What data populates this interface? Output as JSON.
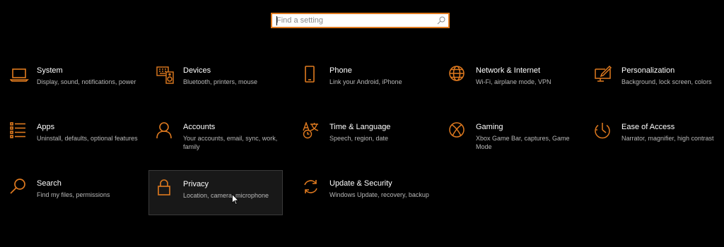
{
  "search": {
    "placeholder": "Find a setting",
    "value": ""
  },
  "accent_color": "#e07a1f",
  "tiles": [
    {
      "title": "System",
      "desc": "Display, sound, notifications, power",
      "icon": "laptop-icon"
    },
    {
      "title": "Devices",
      "desc": "Bluetooth, printers, mouse",
      "icon": "keyboard-speaker-icon"
    },
    {
      "title": "Phone",
      "desc": "Link your Android, iPhone",
      "icon": "phone-icon"
    },
    {
      "title": "Network & Internet",
      "desc": "Wi-Fi, airplane mode, VPN",
      "icon": "globe-icon"
    },
    {
      "title": "Personalization",
      "desc": "Background, lock screen, colors",
      "icon": "brush-monitor-icon"
    },
    {
      "title": "Apps",
      "desc": "Uninstall, defaults, optional features",
      "icon": "apps-list-icon"
    },
    {
      "title": "Accounts",
      "desc": "Your accounts, email, sync, work, family",
      "icon": "person-icon"
    },
    {
      "title": "Time & Language",
      "desc": "Speech, region, date",
      "icon": "time-language-icon"
    },
    {
      "title": "Gaming",
      "desc": "Xbox Game Bar, captures, Game Mode",
      "icon": "xbox-icon"
    },
    {
      "title": "Ease of Access",
      "desc": "Narrator, magnifier, high contrast",
      "icon": "ease-of-access-icon"
    },
    {
      "title": "Search",
      "desc": "Find my files, permissions",
      "icon": "search-icon"
    },
    {
      "title": "Privacy",
      "desc": "Location, camera, microphone",
      "icon": "lock-icon"
    },
    {
      "title": "Update & Security",
      "desc": "Windows Update, recovery, backup",
      "icon": "sync-icon"
    }
  ]
}
